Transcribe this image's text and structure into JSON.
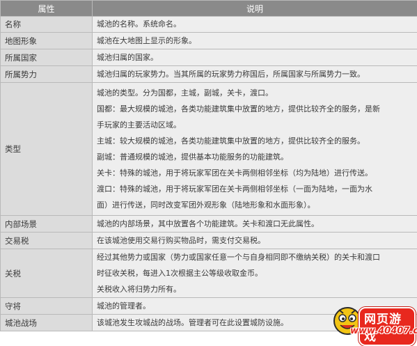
{
  "header": {
    "col_attr": "属性",
    "col_desc": "说明"
  },
  "rows": [
    {
      "name": "名称",
      "lines": [
        "城池的名称。系统命名。"
      ]
    },
    {
      "name": "地图形象",
      "lines": [
        "城池在大地图上显示的形象。"
      ]
    },
    {
      "name": "所属国家",
      "lines": [
        "城池归属的国家。"
      ]
    },
    {
      "name": "所属势力",
      "lines": [
        "城池归属的玩家势力。当其所属的玩家势力称国后，所属国家与所属势力一致。"
      ]
    },
    {
      "name": "类型",
      "lines": [
        "城池的类型。分为国都，主城，副城，关卡，渡口。",
        "国都：最大规模的城池，各类功能建筑集中放置的地方，提供比较齐全的服务，是新",
        "手玩家的主要活动区域。",
        "主城：较大规模的城池，各类功能建筑集中放置的地方，提供比较齐全的服务。",
        "副城：普通规模的城池，提供基本功能服务的功能建筑。",
        "关卡：特殊的城池，用于将玩家军团在关卡两侧相邻坐标（均为陆地）进行传送。",
        "渡口：特殊的城池，用于将玩家军团在关卡两侧相邻坐标（一面为陆地，一面为水",
        "面）进行传送，同时改变军团外观形象（陆地形象和水面形象）。"
      ]
    },
    {
      "name": "内部场景",
      "lines": [
        "城池的内部场景，其中放置各个功能建筑。关卡和渡口无此属性。"
      ]
    },
    {
      "name": "交易税",
      "lines": [
        "在该城池使用交易行购买物品时，需支付交易税。"
      ]
    },
    {
      "name": "关税",
      "lines": [
        "经过其他势力或国家（势力或国家任意一个与自身相同即不缴纳关税）的关卡和渡口",
        "时征收关税，每进入1次根据主公等级收取金币。",
        "关税收入将归势力所有。"
      ]
    },
    {
      "name": "守将",
      "lines": [
        "城池的管理者。"
      ]
    },
    {
      "name": "城池战场",
      "lines": [
        "该城池发生攻城战的战场。管理者可在此设置城防设施。"
      ]
    }
  ],
  "watermark": {
    "title": "网页游戏",
    "url": "www.40407.com",
    "mascot_icon": "cartoon-mascot-icon"
  }
}
